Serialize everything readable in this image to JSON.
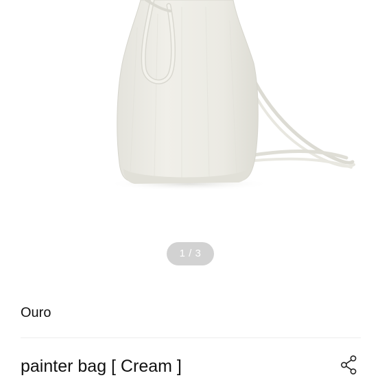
{
  "gallery": {
    "product_image": "bucket-bag-photo",
    "pager_text": "1 / 3",
    "current": 1,
    "total": 3
  },
  "product": {
    "brand": "Ouro",
    "title": "painter bag [ Cream ]"
  },
  "actions": {
    "share_icon": "share-icon"
  },
  "colors": {
    "bag": "#ecebe4",
    "pager_bg": "#d2d2d2",
    "text": "#111111"
  }
}
